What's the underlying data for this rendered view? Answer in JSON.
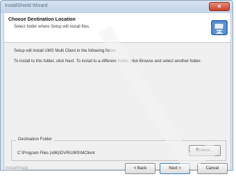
{
  "window": {
    "title": "InstallShield Wizard",
    "close_glyph": "×"
  },
  "header": {
    "title": "Choose Destination Location",
    "subtitle": "Select folder where Setup will install files.",
    "icon": "installer-computer-icon"
  },
  "body": {
    "paragraph1": "Setup will install UMS Multi Client in the following folder.",
    "paragraph2": "To install to this folder, click Next. To install to a different folder, click Browse and select another folder."
  },
  "destination": {
    "legend": "Destination Folder",
    "path": "C:\\Program Files (x86)\\DVR\\UMS\\MClient",
    "browse_label": "Browse..."
  },
  "footer": {
    "brand": "InstallShield",
    "back_label": "< Back",
    "next_label": "Next >",
    "cancel_label": "Cancel"
  },
  "colors": {
    "close_button": "#c7412a",
    "window_frame": "#dde6ef",
    "header_background": "#ffffff",
    "client_background": "#f0f0f0"
  }
}
